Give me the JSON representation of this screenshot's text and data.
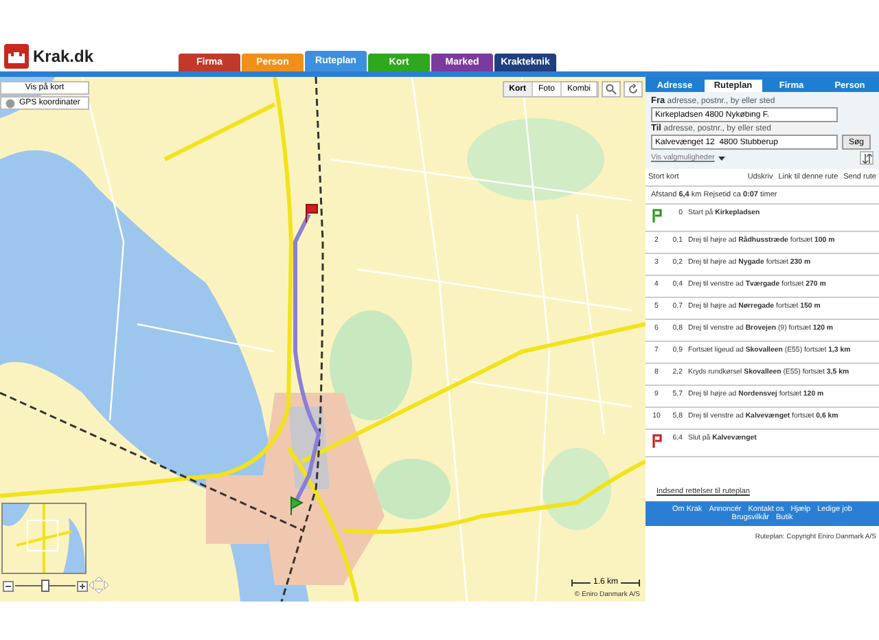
{
  "header": {
    "logo_text": "Krak.dk"
  },
  "nav_tabs": [
    {
      "label": "Firma",
      "color": "#c0392b",
      "selected": false
    },
    {
      "label": "Person",
      "color": "#f0901a",
      "selected": false
    },
    {
      "label": "Ruteplan",
      "color": "#3d8fe0",
      "selected": true
    },
    {
      "label": "Kort",
      "color": "#2ea81c",
      "selected": false
    },
    {
      "label": "Marked",
      "color": "#7b3a9e",
      "selected": false
    },
    {
      "label": "Krakteknik",
      "color": "#1f3f7e",
      "selected": false
    }
  ],
  "map": {
    "show_on_map": "Vis på kort",
    "gps": "GPS koordinater",
    "view_buttons": [
      {
        "label": "Kort",
        "selected": true
      },
      {
        "label": "Foto",
        "selected": false
      },
      {
        "label": "Kombi",
        "selected": false
      }
    ],
    "zoom": {
      "level": 0.5
    },
    "scale": "1.6 km",
    "copyright": "© Eniro Danmark A/S"
  },
  "panel": {
    "tabs": [
      {
        "label": "Adresse",
        "selected": false
      },
      {
        "label": "Ruteplan",
        "selected": true
      },
      {
        "label": "Firma",
        "selected": false
      },
      {
        "label": "Person",
        "selected": false
      }
    ],
    "from_label": "Fra",
    "from_hint": "adresse, postnr., by eller sted",
    "from_value": "Kirkepladsen 4800 Nykøbing F.",
    "to_label": "Til",
    "to_hint": "adresse, postnr., by eller sted",
    "to_value": "Kalvevænget 12  4800 Stubberup",
    "search_button": "Søg",
    "options_link": "Vis valgmuligheder",
    "actions": [
      "Stort kort",
      "Udskriv",
      "Link til denne rute",
      "Send rute"
    ],
    "summary": "Afstand **6,4** km   Rejsetid ca **0:07** timer",
    "steps": [
      {
        "kind": "start",
        "km": "0",
        "text": "Start på **Kirkepladsen**"
      },
      {
        "kind": "step",
        "number": "2",
        "km": "0,1",
        "text": "Drej til højre ad **Rådhusstræde** fortsæt **100 m**"
      },
      {
        "kind": "step",
        "number": "3",
        "km": "0,2",
        "text": "Drej til højre ad **Nygade** fortsæt **230 m**"
      },
      {
        "kind": "step",
        "number": "4",
        "km": "0,4",
        "text": "Drej til venstre ad **Tværgade** fortsæt **270 m**"
      },
      {
        "kind": "step",
        "number": "5",
        "km": "0,7",
        "text": "Drej til højre ad **Nørregade** fortsæt **150 m**"
      },
      {
        "kind": "step",
        "number": "6",
        "km": "0,8",
        "text": "Drej til venstre ad **Brovejen** (9) fortsæt **120 m**"
      },
      {
        "kind": "step",
        "number": "7",
        "km": "0,9",
        "text": "Fortsæt ligeud ad **Skovalleen** (E55) fortsæt **1,3 km**"
      },
      {
        "kind": "step",
        "number": "8",
        "km": "2,2",
        "text": "Kryds rundkørsel **Skovalleen** (E55) fortsæt **3,5 km**"
      },
      {
        "kind": "step",
        "number": "9",
        "km": "5,7",
        "text": "Drej til højre ad **Nordensvej** fortsæt **120 m**"
      },
      {
        "kind": "step",
        "number": "10",
        "km": "5,8",
        "text": "Drej til venstre ad **Kalvevænget** fortsæt **0,6 km**"
      },
      {
        "kind": "end",
        "km": "6,4",
        "text": "Slut på **Kalvevænget**"
      }
    ],
    "feedback_link": "Indsend rettelser til ruteplan",
    "footer_links": [
      "Om Krak",
      "Annoncér",
      "Kontakt os",
      "Hjælp",
      "Ledige job",
      "Brugsvilkår",
      "Butik"
    ],
    "copyright": "Ruteplan: Copyright Eniro Danmark A/S"
  }
}
